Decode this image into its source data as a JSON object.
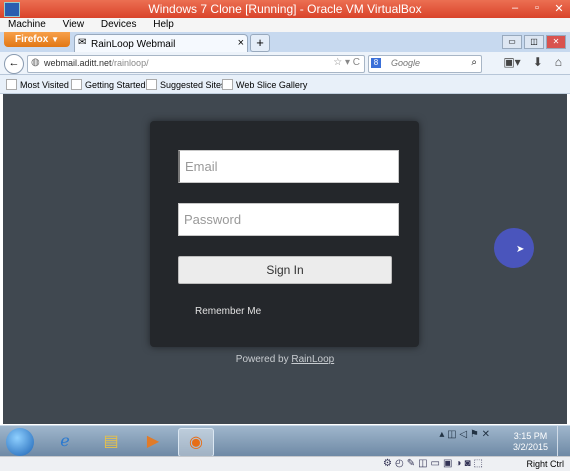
{
  "vbox": {
    "title": "Windows 7 Clone [Running] - Oracle VM VirtualBox",
    "menu": [
      "Machine",
      "View",
      "Devices",
      "Help"
    ],
    "window_buttons": [
      "–",
      "▫",
      "✕"
    ],
    "status_icons": "⚙◴✎◫▭▣◑◙⬚",
    "host_key": "Right Ctrl"
  },
  "firefox": {
    "button_label": "Firefox",
    "tab": {
      "title": "RainLoop Webmail",
      "close": "×"
    },
    "new_tab": "+",
    "window_ctrls": [
      "▭",
      "◫",
      "✕"
    ],
    "back": "←",
    "url_host": "webmail.aditt.net",
    "url_path": "/rainloop/",
    "url_icons": "☆ ▾ C",
    "search_placeholder": "Google",
    "search_engine": "8",
    "search_icon": "⌕",
    "tool_icons": [
      "▣▾",
      "⬇",
      "⌂"
    ],
    "bookmarks": [
      "Most Visited",
      "Getting Started",
      "Suggested Sites",
      "Web Slice Gallery"
    ]
  },
  "login": {
    "email_placeholder": "Email",
    "password_placeholder": "Password",
    "signin_label": "Sign In",
    "remember_label": "Remember Me",
    "powered_prefix": "Powered by ",
    "powered_link": "RainLoop"
  },
  "taskbar": {
    "tray_icons": "▴ ◫ ◁ ⚑ ✕",
    "time": "3:15 PM",
    "date": "3/2/2015"
  },
  "colors": {
    "page_bg": "#404850",
    "card_bg": "#24272b",
    "vbox_title_bg": "#d9432a"
  }
}
